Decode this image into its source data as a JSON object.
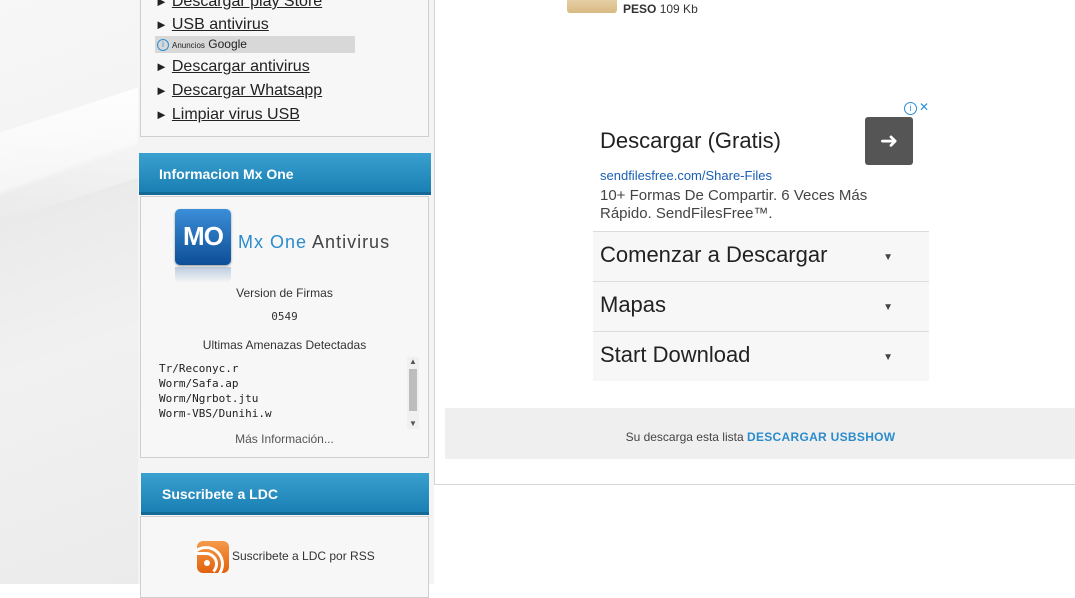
{
  "sidebar": {
    "links": [
      {
        "label": "Descargar play Store"
      },
      {
        "label": "USB antivirus"
      },
      {
        "label": "Descargar antivirus"
      },
      {
        "label": "Descargar Whatsapp"
      },
      {
        "label": "Limpiar virus USB"
      }
    ],
    "ads_bar": {
      "small": "Anuncios",
      "brand": "Google"
    },
    "info_section": {
      "title": "Informacion Mx One",
      "logo_text": "MO",
      "brand_blue": "Mx One",
      "brand_dark": "Antivirus",
      "firmas_label": "Version de Firmas",
      "firmas_value": "0549",
      "threats_label": "Ultimas Amenazas Detectadas",
      "threats": [
        "Tr/Reconyc.r",
        "Worm/Safa.ap",
        "Worm/Ngrbot.jtu",
        "Worm-VBS/Dunihi.w"
      ],
      "more_link": "Más Información..."
    },
    "subscribe_section": {
      "title": "Suscribete a LDC",
      "rss_text": "Suscribete a LDC por RSS"
    }
  },
  "main": {
    "peso_label": "PESO",
    "peso_value": "109 Kb",
    "ad": {
      "title": "Descargar (Gratis)",
      "url": "sendfilesfree.com/Share-Files",
      "description": "10+ Formas De Compartir. 6 Veces Más Rápido. SendFilesFree™.",
      "rows": [
        "Comenzar a Descargar",
        "Mapas",
        "Start Download"
      ]
    },
    "download_bar": {
      "text": "Su descarga esta lista",
      "link": "DESCARGAR USBSHOW"
    }
  },
  "colors": {
    "header_blue": "#1a7fb3",
    "link_blue": "#2b8ccc",
    "rss_orange": "#e2620d"
  }
}
